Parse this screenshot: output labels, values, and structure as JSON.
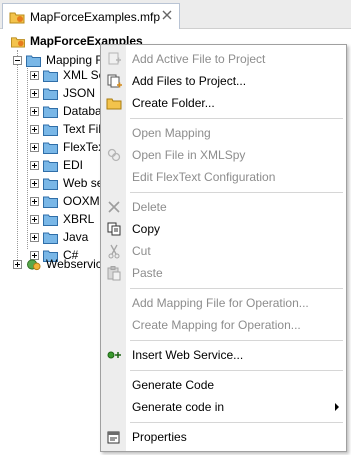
{
  "tab": {
    "title": "MapForceExamples.mfp"
  },
  "tree": {
    "root": "MapForceExamples",
    "children": [
      "Mapping F",
      "XML Sc",
      "JSON",
      "Databas",
      "Text File",
      "FlexText",
      "EDI",
      "Web se",
      "OOXML",
      "XBRL",
      "Java",
      "C#",
      "Webservic"
    ]
  },
  "menu": {
    "items": [
      {
        "label": "Add Active File to Project",
        "enabled": false,
        "icon": "add-active-file-icon"
      },
      {
        "label": "Add Files to Project...",
        "enabled": true,
        "icon": "add-files-icon"
      },
      {
        "label": "Create Folder...",
        "enabled": true,
        "icon": "folder-icon"
      },
      {
        "label": "Open Mapping",
        "enabled": false,
        "icon": ""
      },
      {
        "label": "Open File in XMLSpy",
        "enabled": false,
        "icon": "xmlspy-icon"
      },
      {
        "label": "Edit FlexText Configuration",
        "enabled": false,
        "icon": ""
      },
      {
        "label": "Delete",
        "enabled": false,
        "icon": "delete-icon"
      },
      {
        "label": "Copy",
        "enabled": true,
        "icon": "copy-icon"
      },
      {
        "label": "Cut",
        "enabled": false,
        "icon": "cut-icon"
      },
      {
        "label": "Paste",
        "enabled": false,
        "icon": "paste-icon"
      },
      {
        "label": "Add Mapping File for Operation...",
        "enabled": false,
        "icon": ""
      },
      {
        "label": "Create Mapping for Operation...",
        "enabled": false,
        "icon": ""
      },
      {
        "label": "Insert Web Service...",
        "enabled": true,
        "icon": "insert-web-service-icon"
      },
      {
        "label": "Generate Code",
        "enabled": true,
        "icon": ""
      },
      {
        "label": "Generate code in",
        "enabled": true,
        "icon": "",
        "submenu": true
      },
      {
        "label": "Properties",
        "enabled": true,
        "icon": "properties-icon"
      }
    ]
  }
}
